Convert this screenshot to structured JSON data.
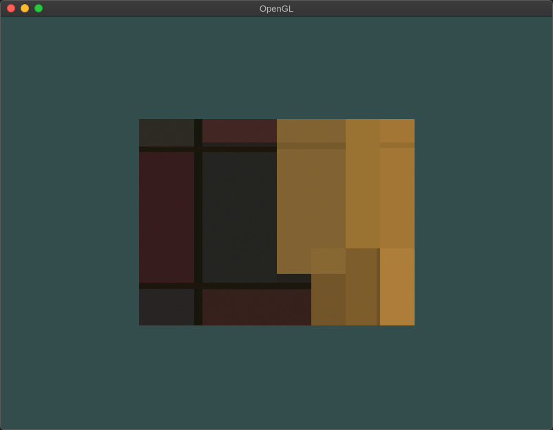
{
  "window": {
    "title": "OpenGL"
  },
  "colors": {
    "clear_color": "#334c4c",
    "titlebar": "#383838",
    "title_text": "#b8b8b8",
    "close": "#fe5f57",
    "minimize": "#febc2e",
    "maximize": "#28c840"
  },
  "scene": {
    "background_texture": "dark-brick-pavement",
    "overlay_texture": "orange-brick-pavement"
  }
}
